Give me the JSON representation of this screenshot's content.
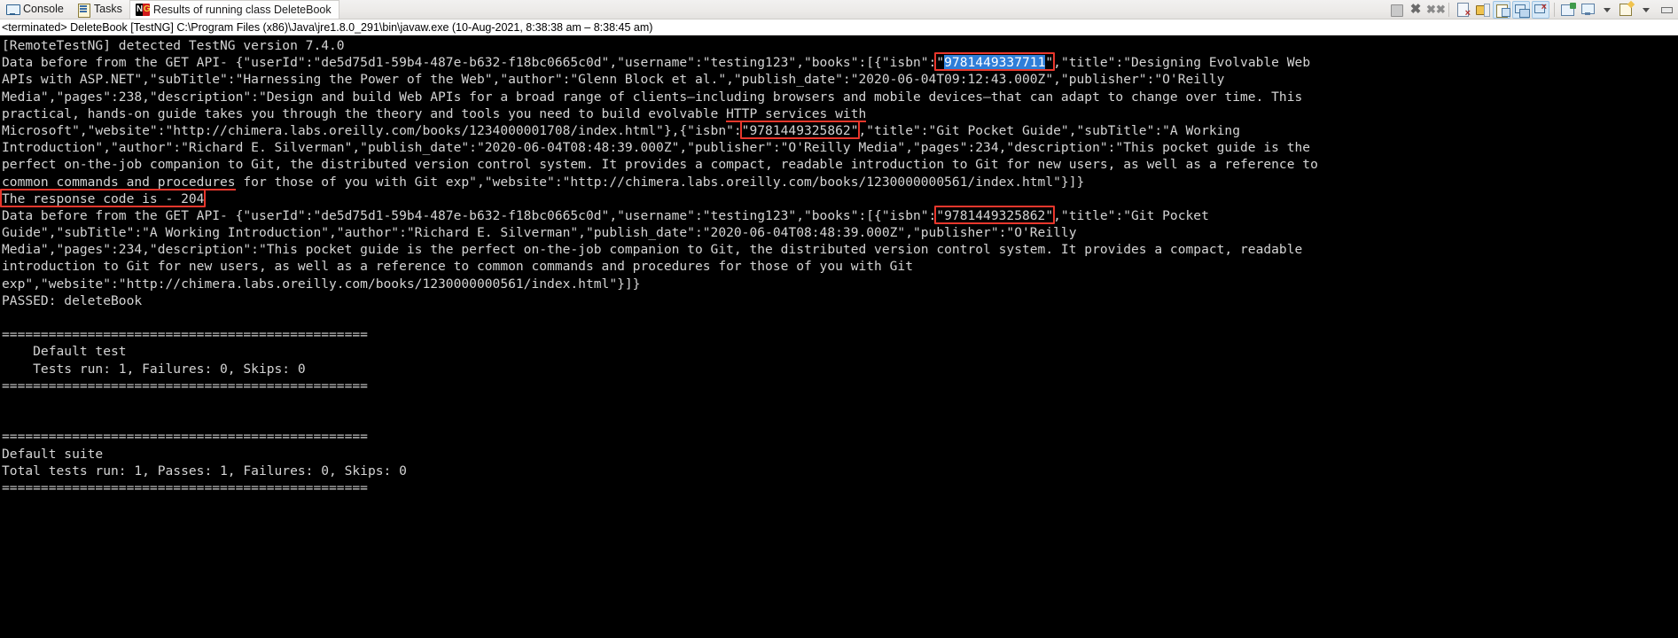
{
  "window": {
    "tabs": [
      {
        "label": "Console",
        "icon": "console-icon",
        "active": false
      },
      {
        "label": "Tasks",
        "icon": "tasks-icon",
        "active": false
      },
      {
        "label": "Results of running class DeleteBook",
        "icon": "testng-icon",
        "active": true
      }
    ],
    "toolbar_buttons": [
      {
        "name": "terminate-button",
        "icon": "stop-icon",
        "label": "Terminate"
      },
      {
        "name": "remove-launch-button",
        "icon": "remove-x-icon",
        "label": "Remove Launch"
      },
      {
        "name": "remove-all-terminated-button",
        "icon": "remove-all-x-icon",
        "label": "Remove All Terminated Launches"
      },
      {
        "name": "clear-console-button",
        "icon": "clear-console-icon",
        "label": "Clear Console"
      },
      {
        "name": "scroll-lock-button",
        "icon": "scroll-lock-icon",
        "label": "Scroll Lock"
      },
      {
        "name": "word-wrap-button",
        "icon": "word-wrap-icon",
        "label": "Word Wrap"
      },
      {
        "name": "show-console-on-output-button",
        "icon": "show-console-output-icon",
        "label": "Show Console When Standard Out Changes"
      },
      {
        "name": "show-console-on-error-button",
        "icon": "show-console-error-icon",
        "label": "Show Console When Standard Error Changes"
      },
      {
        "name": "pin-console-button",
        "icon": "pin-console-icon",
        "label": "Pin Console"
      },
      {
        "name": "display-selected-console-button",
        "icon": "display-console-icon",
        "label": "Display Selected Console"
      },
      {
        "name": "display-console-dropdown",
        "icon": "chevron-down-icon",
        "label": "Display Selected Console Menu"
      },
      {
        "name": "open-console-button",
        "icon": "new-console-icon",
        "label": "Open Console"
      },
      {
        "name": "open-console-dropdown",
        "icon": "chevron-down-icon",
        "label": "Open Console Menu"
      },
      {
        "name": "minimize-view-button",
        "icon": "minimize-icon",
        "label": "Minimize"
      }
    ],
    "process_header": "<terminated> DeleteBook [TestNG] C:\\Program Files (x86)\\Java\\jre1.8.0_291\\bin\\javaw.exe  (10-Aug-2021, 8:38:38 am – 8:38:45 am)"
  },
  "console": {
    "lines": [
      "[RemoteTestNG] detected TestNG version 7.4.0",
      "Data before from the GET API- {\"userId\":\"de5d75d1-59b4-487e-b632-f18bc0665c0d\",\"username\":\"testing123\",\"books\":[{\"isbn\":\"9781449337711\",\"title\":\"Designing Evolvable Web",
      "APIs with ASP.NET\",\"subTitle\":\"Harnessing the Power of the Web\",\"author\":\"Glenn Block et al.\",\"publish_date\":\"2020-06-04T09:12:43.000Z\",\"publisher\":\"O'Reilly",
      "Media\",\"pages\":238,\"description\":\"Design and build Web APIs for a broad range of clients—including browsers and mobile devices—that can adapt to change over time. This",
      "practical, hands-on guide takes you through the theory and tools you need to build evolvable HTTP services with",
      "Microsoft\",\"website\":\"http://chimera.labs.oreilly.com/books/1234000001708/index.html\"},{\"isbn\":\"9781449325862\",\"title\":\"Git Pocket Guide\",\"subTitle\":\"A Working",
      "Introduction\",\"author\":\"Richard E. Silverman\",\"publish_date\":\"2020-06-04T08:48:39.000Z\",\"publisher\":\"O'Reilly Media\",\"pages\":234,\"description\":\"This pocket guide is the",
      "perfect on-the-job companion to Git, the distributed version control system. It provides a compact, readable introduction to Git for new users, as well as a reference to",
      "common commands and procedures for those of you with Git exp\",\"website\":\"http://chimera.labs.oreilly.com/books/1230000000561/index.html\"}]}",
      "The response code is - 204",
      "Data before from the GET API- {\"userId\":\"de5d75d1-59b4-487e-b632-f18bc0665c0d\",\"username\":\"testing123\",\"books\":[{\"isbn\":\"9781449325862\",\"title\":\"Git Pocket",
      "Guide\",\"subTitle\":\"A Working Introduction\",\"author\":\"Richard E. Silverman\",\"publish_date\":\"2020-06-04T08:48:39.000Z\",\"publisher\":\"O'Reilly",
      "Media\",\"pages\":234,\"description\":\"This pocket guide is the perfect on-the-job companion to Git, the distributed version control system. It provides a compact, readable",
      "introduction to Git for new users, as well as a reference to common commands and procedures for those of you with Git",
      "exp\",\"website\":\"http://chimera.labs.oreilly.com/books/1230000000561/index.html\"}]}",
      "PASSED: deleteBook",
      "",
      "===============================================",
      "    Default test",
      "    Tests run: 1, Failures: 0, Skips: 0",
      "===============================================",
      "",
      "",
      "===============================================",
      "Default suite",
      "Total tests run: 1, Passes: 1, Failures: 0, Skips: 0",
      "==============================================="
    ],
    "selection_highlight": {
      "text": "9781449337711",
      "background_color": "#2f7ed8",
      "text_color": "#ffffff"
    },
    "annotations": [
      {
        "name": "isbn-box-1",
        "type": "box",
        "text": "\"9781449337711\""
      },
      {
        "name": "isbn-box-2",
        "type": "box",
        "text": "\"9781449325862\""
      },
      {
        "name": "isbn-box-3",
        "type": "box",
        "text": "\"9781449325862\""
      },
      {
        "name": "response-code-box",
        "type": "box",
        "text": "The response code is - 204"
      },
      {
        "name": "http-services-underline",
        "type": "underline",
        "text": "HTTP services with"
      },
      {
        "name": "common-commands-underline",
        "type": "underline",
        "text": "common commands and procedures"
      }
    ],
    "annotation_color": "#e8372c",
    "background_color": "#000000",
    "text_color": "#d4d4d4"
  }
}
